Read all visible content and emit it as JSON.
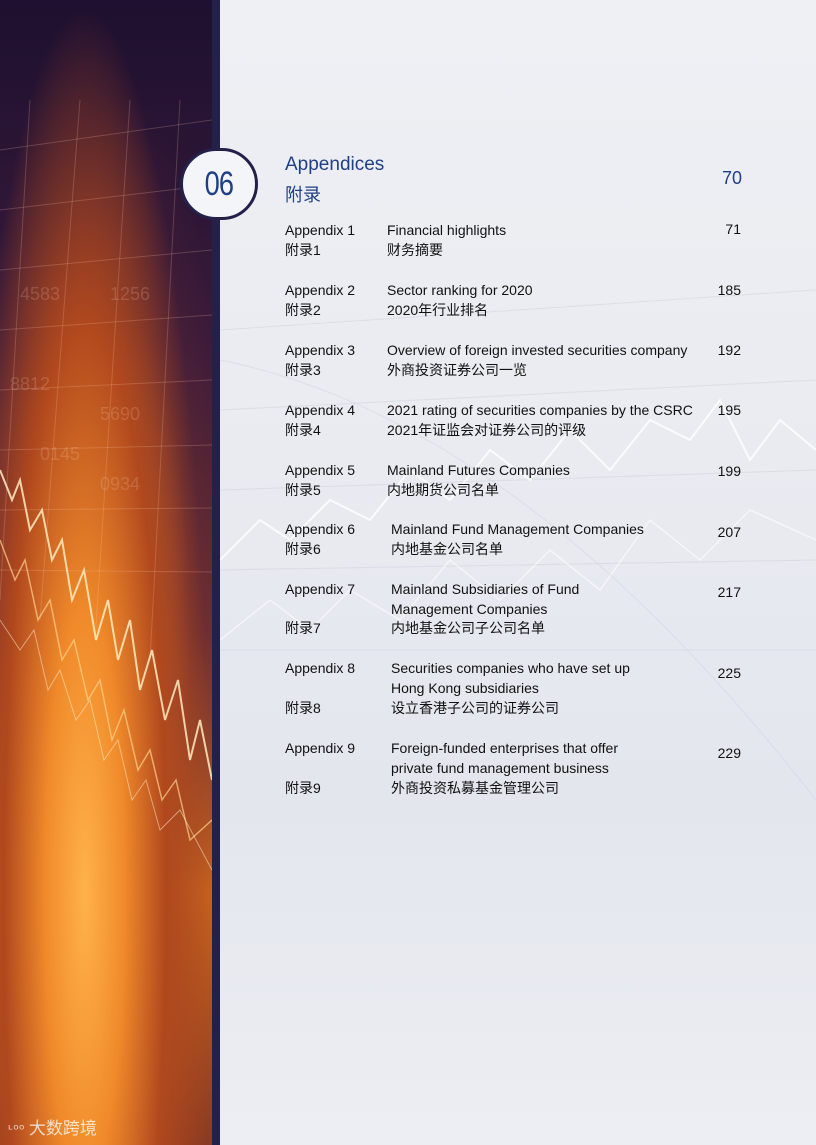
{
  "chapter": {
    "number": "06"
  },
  "section": {
    "title_en": "Appendices",
    "title_cn": "附录",
    "page": "70"
  },
  "entries": [
    {
      "label_en": "Appendix 1",
      "label_cn": "附录1",
      "desc_en": "Financial highlights",
      "desc_cn": "财务摘要",
      "page": "71"
    },
    {
      "label_en": "Appendix 2",
      "label_cn": "附录2",
      "desc_en": "Sector ranking for 2020",
      "desc_cn": "2020年行业排名",
      "page": "185"
    },
    {
      "label_en": "Appendix 3",
      "label_cn": "附录3",
      "desc_en": "Overview of foreign invested securities company",
      "desc_cn": "外商投资证券公司一览",
      "page": "192"
    },
    {
      "label_en": "Appendix 4",
      "label_cn": "附录4",
      "desc_en": "2021 rating of securities companies by the CSRC",
      "desc_cn": "2021年证监会对证券公司的评级",
      "page": "195"
    },
    {
      "label_en": "Appendix 5",
      "label_cn": "附录5",
      "desc_en": "Mainland Futures Companies",
      "desc_cn": "内地期货公司名单",
      "page": "199"
    },
    {
      "label_en": "Appendix 6",
      "label_cn": "附录6",
      "desc_en": "Mainland Fund Management Companies",
      "desc_cn": "内地基金公司名单",
      "page": "207"
    },
    {
      "label_en": "Appendix 7",
      "label_cn": "附录7",
      "desc_en_1": "Mainland Subsidiaries of Fund",
      "desc_en_2": "Management Companies",
      "desc_cn": "内地基金公司子公司名单",
      "page": "217"
    },
    {
      "label_en": "Appendix 8",
      "label_cn": "附录8",
      "desc_en_1": "Securities companies who have set up",
      "desc_en_2": "Hong Kong subsidiaries",
      "desc_cn": "设立香港子公司的证券公司",
      "page": "225"
    },
    {
      "label_en": "Appendix 9",
      "label_cn": "附录9",
      "desc_en_1": "Foreign-funded enterprises that offer",
      "desc_en_2": "private fund management business",
      "desc_cn": "外商投资私募基金管理公司",
      "page": "229"
    }
  ],
  "watermark": {
    "text": "大数跨境"
  }
}
